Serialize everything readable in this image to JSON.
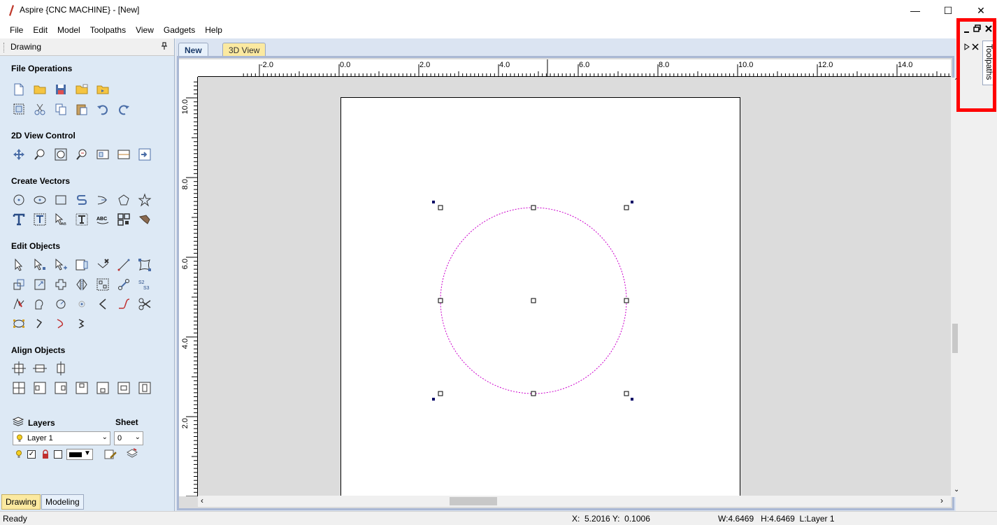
{
  "window": {
    "title": "Aspire {CNC MACHINE} - [New]",
    "minimize": "—",
    "maximize": "☐",
    "close": "✕"
  },
  "menu": [
    "File",
    "Edit",
    "Model",
    "Toolpaths",
    "View",
    "Gadgets",
    "Help"
  ],
  "left_panel": {
    "title": "Drawing",
    "sections": {
      "file_operations": "File Operations",
      "view_control": "2D View Control",
      "create_vectors": "Create Vectors",
      "edit_objects": "Edit Objects",
      "align_objects": "Align Objects"
    },
    "layers": {
      "label": "Layers",
      "sheet_label": "Sheet",
      "layer_value": "Layer 1",
      "sheet_value": "0"
    },
    "bottom_tabs": [
      "Drawing",
      "Modeling"
    ]
  },
  "doc_tabs": [
    "New",
    "3D View"
  ],
  "rulers": {
    "horizontal": [
      "-2.0",
      "0.0",
      "2.0",
      "4.0",
      "6.0",
      "8.0",
      "10.0",
      "12.0",
      "14.0"
    ],
    "vertical": [
      "10.0",
      "8.0",
      "6.0",
      "4.0",
      "2.0"
    ]
  },
  "right_panel": {
    "tab_label": "Toolpaths"
  },
  "status": {
    "ready": "Ready",
    "coords": "X:  5.2016 Y:  0.1006",
    "size": "W:4.6469   H:4.6469  L:Layer 1"
  },
  "colors": {
    "circle": "#cc00cc",
    "panel_bg": "#dde9f5",
    "highlight": "#ff0000",
    "tab_active": "#e8f1fb",
    "tab_inactive": "#fbe9a0"
  }
}
